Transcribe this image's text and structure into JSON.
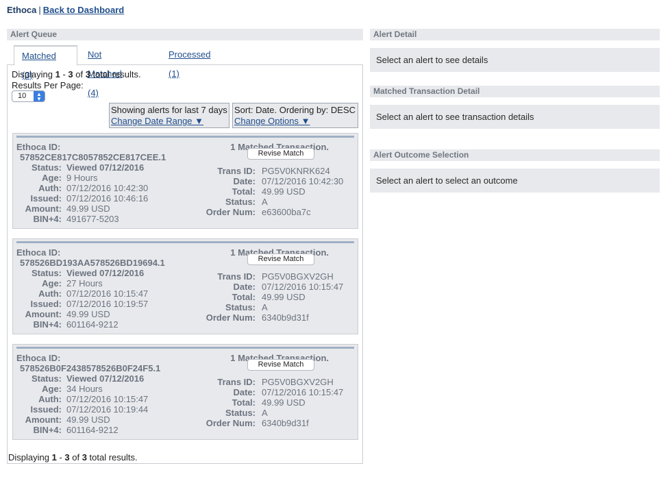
{
  "topbar": {
    "brand": "Ethoca",
    "separator": "|",
    "back_link": "Back to Dashboard"
  },
  "queue": {
    "header": "Alert Queue",
    "tabs": [
      {
        "label": "Matched (3)",
        "active": true
      },
      {
        "label": "Not Matched (4)",
        "active": false
      },
      {
        "label": "Processed (1)",
        "active": false
      }
    ],
    "display": {
      "prefix": "Displaying ",
      "from": "1",
      "dash": " - ",
      "to": "3",
      "of": " of ",
      "total": "3",
      "suffix": " total results."
    },
    "rpp_label": "Results Per Page:",
    "rpp_value": "10",
    "filter_date": {
      "text": "Showing alerts for last 7 days",
      "link": "Change Date Range ▼"
    },
    "filter_sort": {
      "text": "Sort: Date. Ordering by: DESC",
      "link": "Change Options ▼"
    }
  },
  "card_labels": {
    "ethoca_id": "Ethoca ID:",
    "status": "Status:",
    "age": "Age:",
    "auth": "Auth:",
    "issued": "Issued:",
    "amount": "Amount:",
    "bin": "BIN+4:",
    "matched": "1 Matched Transaction.",
    "revise": "Revise Match",
    "trans_id": "Trans ID:",
    "date": "Date:",
    "total": "Total:",
    "t_status": "Status:",
    "order_num": "Order Num:"
  },
  "alerts": [
    {
      "ethoca_id": "57852CE817C8057852CE817CEE.1",
      "status": "Viewed 07/12/2016",
      "age": "9 Hours",
      "auth": "07/12/2016 10:42:30",
      "issued": "07/12/2016 10:46:16",
      "amount": "49.99 USD",
      "bin": "491677-5203",
      "trans_id": "PG5V0KNRK624",
      "date": "07/12/2016 10:42:30",
      "total": "49.99 USD",
      "t_status": "A",
      "order_num": "e63600ba7c"
    },
    {
      "ethoca_id": "578526BD193AA578526BD19694.1",
      "status": "Viewed 07/12/2016",
      "age": "27 Hours",
      "auth": "07/12/2016 10:15:47",
      "issued": "07/12/2016 10:19:57",
      "amount": "49.99 USD",
      "bin": "601164-9212",
      "trans_id": "PG5V0BGXV2GH",
      "date": "07/12/2016 10:15:47",
      "total": "49.99 USD",
      "t_status": "A",
      "order_num": "6340b9d31f"
    },
    {
      "ethoca_id": "578526B0F2438578526B0F24F5.1",
      "status": "Viewed 07/12/2016",
      "age": "34 Hours",
      "auth": "07/12/2016 10:15:47",
      "issued": "07/12/2016 10:19:44",
      "amount": "49.99 USD",
      "bin": "601164-9212",
      "trans_id": "PG5V0BGXV2GH",
      "date": "07/12/2016 10:15:47",
      "total": "49.99 USD",
      "t_status": "A",
      "order_num": "6340b9d31f"
    }
  ],
  "right": {
    "alert_detail": {
      "header": "Alert Detail",
      "message": "Select an alert to see details"
    },
    "matched_detail": {
      "header": "Matched Transaction Detail",
      "message": "Select an alert to see transaction details"
    },
    "outcome": {
      "header": "Alert Outcome Selection",
      "message": "Select an alert to select an outcome"
    }
  }
}
